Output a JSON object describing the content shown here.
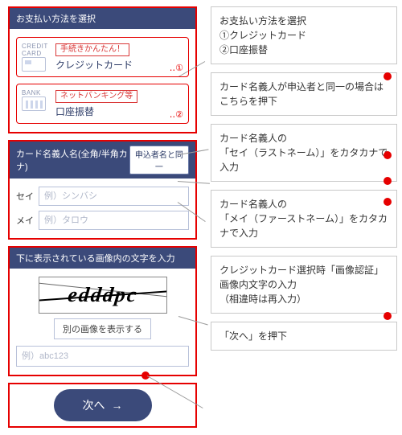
{
  "pay": {
    "section_title": "お支払い方法を選択",
    "credit": {
      "chip": "CREDIT CARD",
      "badge": "手続きかんたん！",
      "name": "クレジットカード",
      "num_dots": "‥",
      "num": "①"
    },
    "bank": {
      "chip": "BANK",
      "badge": "ネットバンキング等",
      "name": "口座振替",
      "num_dots": "‥",
      "num": "②"
    }
  },
  "name_section": {
    "title": "カード名義人名(全角/半角カナ)",
    "same_button": "申込者名と同一",
    "sei_label": "セイ",
    "sei_placeholder": "例）シンバシ",
    "mei_label": "メイ",
    "mei_placeholder": "例）タロウ"
  },
  "captcha": {
    "title": "下に表示されている画像内の文字を入力",
    "image_text": "edddpc",
    "reload": "別の画像を表示する",
    "placeholder": "例）abc123"
  },
  "next": {
    "label": "次へ",
    "arrow": "→"
  },
  "notes": {
    "n1_line1": "お支払い方法を選択",
    "n1_line2": "①クレジットカード",
    "n1_line3": "②口座振替",
    "n2_line1": "カード名義人が申込者と同一の場合はこちらを押下",
    "n3_line1": "カード名義人の",
    "n3_line2": "「セイ（ラストネーム）」をカタカナで入力",
    "n4_line1": "カード名義人の",
    "n4_line2": "「メイ（ファーストネーム）」をカタカナで入力",
    "n5_line1": "クレジットカード選択時「画像認証」",
    "n5_line2": "画像内文字の入力",
    "n5_line3": "（相違時は再入力）",
    "n6_line1": "「次へ」を押下"
  }
}
